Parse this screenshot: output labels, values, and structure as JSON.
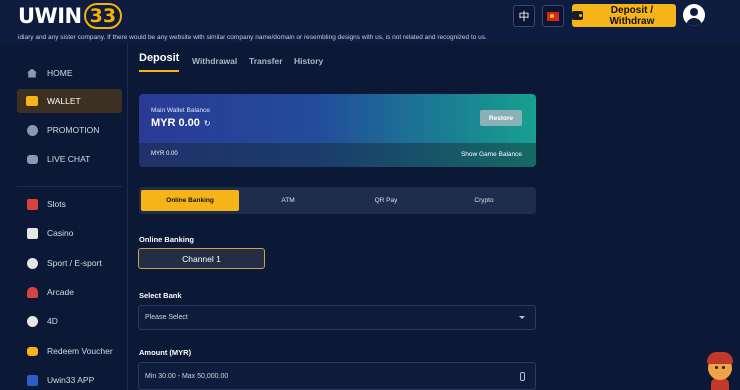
{
  "header": {
    "logo_text": "UWIN",
    "logo_number": "33",
    "lang_label": "中",
    "deposit_withdraw_label": "Deposit / Withdraw"
  },
  "marquee_text": "idiary and any sister company. If there would be any website with similar company name/domain or resembling designs with us, is not related and recognized to us.",
  "sidebar": {
    "items": [
      {
        "label": "HOME",
        "icon": "home-icon"
      },
      {
        "label": "WALLET",
        "icon": "wallet-icon"
      },
      {
        "label": "PROMOTION",
        "icon": "promotion-icon"
      },
      {
        "label": "LIVE CHAT",
        "icon": "chat-icon"
      },
      {
        "label": "Slots",
        "icon": "slots-icon"
      },
      {
        "label": "Casino",
        "icon": "casino-icon"
      },
      {
        "label": "Sport / E-sport",
        "icon": "sport-icon"
      },
      {
        "label": "Arcade",
        "icon": "arcade-icon"
      },
      {
        "label": "4D",
        "icon": "4d-icon"
      },
      {
        "label": "Redeem Voucher",
        "icon": "voucher-icon"
      },
      {
        "label": "Uwin33 APP",
        "icon": "app-icon"
      }
    ]
  },
  "tabs": [
    "Deposit",
    "Withdrawal",
    "Transfer",
    "History"
  ],
  "balance": {
    "label": "Main Wallet Balance",
    "amount": "MYR 0.00",
    "restore_label": "Restore",
    "secondary": "MYR 0.00",
    "show_game_label": "Show Game Balance"
  },
  "methods": [
    "Online Banking",
    "ATM",
    "QR Pay",
    "Crypto"
  ],
  "online_banking": {
    "label": "Online Banking",
    "channel": "Channel 1"
  },
  "select_bank": {
    "label": "Select Bank",
    "value": "Please Select"
  },
  "amount": {
    "label": "Amount (MYR)",
    "placeholder": "Min  30.00 - Max 50,000.00"
  },
  "colors": {
    "accent": "#f6b419",
    "background": "#0b1836"
  }
}
